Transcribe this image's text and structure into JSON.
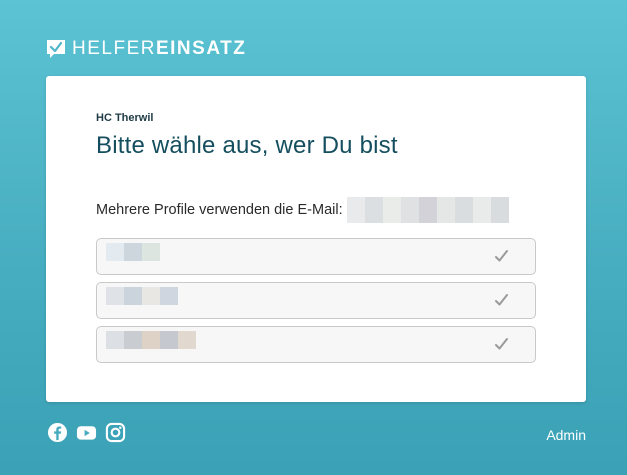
{
  "brand": {
    "part1": "HELFER",
    "part2": "EINSATZ",
    "icon": "check-bubble-icon"
  },
  "card": {
    "club": "HC Therwil",
    "title": "Bitte wähle aus, wer Du bist",
    "email_label": "Mehrere Profile verwenden die E-Mail:",
    "email_value": "",
    "profiles": [
      {
        "name": "",
        "icon": "checkmark-icon"
      },
      {
        "name": "",
        "icon": "checkmark-icon"
      },
      {
        "name": "",
        "icon": "checkmark-icon"
      }
    ]
  },
  "footer": {
    "social": [
      "facebook-icon",
      "youtube-icon",
      "instagram-icon"
    ],
    "admin_label": "Admin"
  },
  "colors": {
    "background_top": "#5bc3d3",
    "background_bottom": "#3aa1b6",
    "heading": "#154e5e",
    "card": "#ffffff",
    "profile_bg": "#f7f7f7"
  }
}
